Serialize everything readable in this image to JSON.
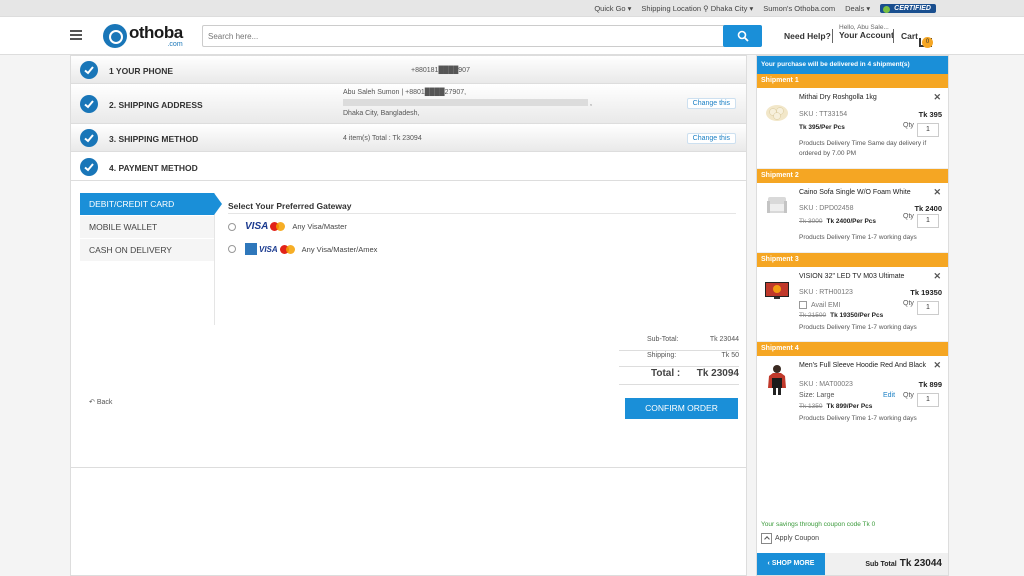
{
  "topbar": {
    "quick_go": "Quick Go ▾",
    "shipping_location": "Shipping Location ⚲ Dhaka City ▾",
    "sumons": "Sumon's Othoba.com",
    "deals": "Deals ▾",
    "certified": "CERTIFIED"
  },
  "header": {
    "logo_main": "othoba",
    "logo_sub": ".com",
    "search_placeholder": "Search here...",
    "need_help": "Need Help?",
    "hello": "Hello, Abu Sale...",
    "your_account": "Your Account",
    "cart": "Cart",
    "cart_count": "0"
  },
  "steps": [
    {
      "label": "1 YOUR PHONE",
      "info": "+880181████907",
      "action": ""
    },
    {
      "label": "2. SHIPPING ADDRESS",
      "info_line1": "Abu Saleh Sumon | +8801████27907,",
      "info_line3": "Dhaka City, Bangladesh,",
      "action": "Change this"
    },
    {
      "label": "3. SHIPPING METHOD",
      "info": "4 item(s) Total : Tk 23094",
      "action": "Change this"
    },
    {
      "label": "4. PAYMENT METHOD"
    }
  ],
  "payment_tabs": [
    "DEBIT/CREDIT CARD",
    "MOBILE WALLET",
    "CASH ON DELIVERY"
  ],
  "gateway": {
    "title": "Select Your Preferred Gateway",
    "options": [
      {
        "brand": "VISA",
        "label": "Any Visa/Master"
      },
      {
        "brand": "VISA",
        "label": "Any Visa/Master/Amex"
      }
    ]
  },
  "totals": {
    "subtotal_label": "Sub-Total:",
    "subtotal": "Tk 23044",
    "shipping_label": "Shipping:",
    "shipping": "Tk 50",
    "total_label": "Total :",
    "total": "Tk 23094"
  },
  "back": "Back",
  "confirm": "CONFIRM ORDER",
  "sidebar": {
    "header": "Your purchase will be delivered in 4 shipment(s)",
    "shipments": [
      {
        "title": "Shipment 1",
        "name": "Mithai Dry Roshgolla 1kg",
        "sku": "SKU : TT33154",
        "price": "Tk 395",
        "old": "",
        "per": "Tk 395/Per Pcs",
        "qty_label": "Qty",
        "qty": "1",
        "delivery": "Products Delivery Time Same day delivery if ordered by 7.00 PM"
      },
      {
        "title": "Shipment 2",
        "name": "Caino Sofa Single W/O Foam White",
        "sku": "SKU : DPD02458",
        "price": "Tk 2400",
        "old": "Tk 3000",
        "per": "Tk 2400/Per Pcs",
        "qty_label": "Qty",
        "qty": "1",
        "delivery": "Products Delivery Time 1-7 working days"
      },
      {
        "title": "Shipment 3",
        "name": "VISION 32\" LED TV M03 Ultimate",
        "sku": "SKU : RTH00123",
        "price": "Tk 19350",
        "emi": "Avail EMI",
        "old": "Tk 21500",
        "per": "Tk 19350/Per Pcs",
        "qty_label": "Qty",
        "qty": "1",
        "delivery": "Products Delivery Time 1-7 working days"
      },
      {
        "title": "Shipment 4",
        "name": "Men's Full Sleeve Hoodie Red And Black",
        "sku": "SKU : MAT00023",
        "price": "Tk 899",
        "size": "Size: Large",
        "edit": "Edit",
        "old": "Tk 1350",
        "per": "Tk 899/Per Pcs",
        "qty_label": "Qty",
        "qty": "1",
        "delivery": "Products Delivery Time 1-7 working days"
      }
    ],
    "savings": "Your savings through coupon code Tk 0",
    "apply_coupon": "Apply Coupon",
    "shop_more": "SHOP MORE",
    "sub_total_label": "Sub Total",
    "sub_total": "Tk 23044"
  },
  "colors": {
    "accent": "#1a8fd8",
    "shipment": "#f5a623",
    "brand": "#1976b8"
  }
}
